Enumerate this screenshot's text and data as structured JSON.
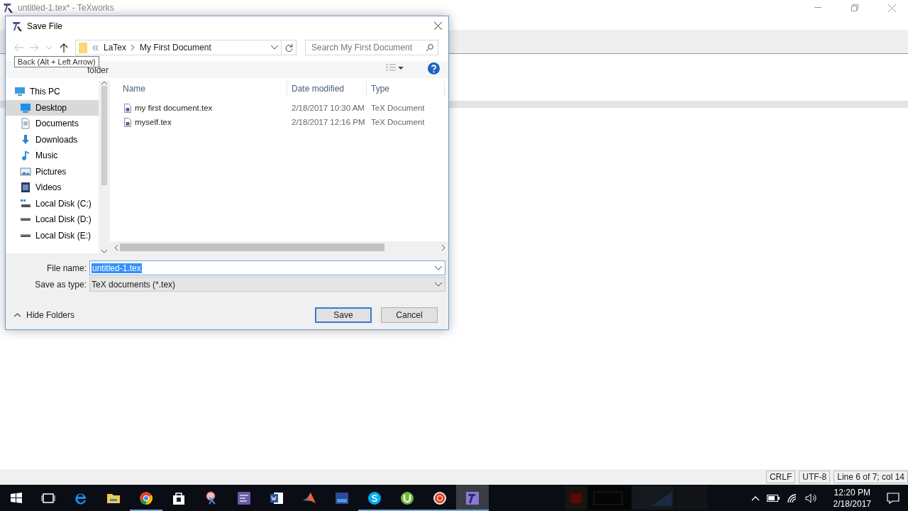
{
  "app_window": {
    "title": "untitled-1.tex* - TeXworks"
  },
  "dialog": {
    "title": "Save File",
    "address": {
      "path": [
        "LaTex",
        "My First Document"
      ]
    },
    "search": {
      "placeholder": "Search My First Document"
    },
    "tooltip": "Back (Alt + Left Arrow)",
    "toolbar": {
      "new_folder": "folder"
    },
    "sidebar": {
      "items": [
        {
          "label": "This PC",
          "kind": "pc",
          "selected": false,
          "children": [
            {
              "label": "Desktop",
              "kind": "desktop",
              "selected": true
            },
            {
              "label": "Documents",
              "kind": "documents",
              "selected": false
            },
            {
              "label": "Downloads",
              "kind": "downloads",
              "selected": false
            },
            {
              "label": "Music",
              "kind": "music",
              "selected": false
            },
            {
              "label": "Pictures",
              "kind": "pictures",
              "selected": false
            },
            {
              "label": "Videos",
              "kind": "videos",
              "selected": false
            },
            {
              "label": "Local Disk (C:)",
              "kind": "system-drive",
              "selected": false
            },
            {
              "label": "Local Disk (D:)",
              "kind": "drive",
              "selected": false
            },
            {
              "label": "Local Disk (E:)",
              "kind": "drive",
              "selected": false
            }
          ]
        }
      ]
    },
    "table": {
      "columns": [
        "Name",
        "Date modified",
        "Type"
      ],
      "rows": [
        {
          "name": "my first document.tex",
          "date": "2/18/2017 10:30 AM",
          "type": "TeX Document",
          "selected": false
        },
        {
          "name": "myself.tex",
          "date": "2/18/2017 12:16 PM",
          "type": "TeX Document",
          "selected": false
        }
      ]
    },
    "file_name": {
      "label": "File name:",
      "value": "untitled-1.tex",
      "text_selected": true
    },
    "save_type": {
      "label": "Save as type:",
      "value": "TeX documents (*.tex)"
    },
    "hide_folders": "Hide Folders",
    "buttons": [
      {
        "label": "Save",
        "default": true
      },
      {
        "label": "Cancel",
        "default": false
      }
    ]
  },
  "status_bar": [
    "CRLF",
    "UTF-8",
    "Line 6 of 7; col 14"
  ],
  "taskbar": {
    "apps": [
      {
        "kind": "start",
        "running": false,
        "active": false
      },
      {
        "kind": "task-view",
        "running": false,
        "active": false
      },
      {
        "kind": "edge",
        "running": false,
        "active": false
      },
      {
        "kind": "explorer",
        "running": false,
        "active": false
      },
      {
        "kind": "chrome",
        "running": true,
        "active": false
      },
      {
        "kind": "store",
        "running": false,
        "active": false
      },
      {
        "kind": "snip",
        "running": false,
        "active": false
      },
      {
        "kind": "equalizer",
        "running": false,
        "active": false
      },
      {
        "kind": "word",
        "running": false,
        "active": false
      },
      {
        "kind": "matlab",
        "running": false,
        "active": false
      },
      {
        "kind": "devcpp",
        "running": false,
        "active": false
      },
      {
        "kind": "skype",
        "running": true,
        "active": false
      },
      {
        "kind": "utorrent",
        "running": true,
        "active": false
      },
      {
        "kind": "recorder",
        "running": true,
        "active": false
      },
      {
        "kind": "texworks",
        "running": true,
        "active": true
      }
    ],
    "time": "12:20 PM",
    "date": "2/18/2017"
  }
}
